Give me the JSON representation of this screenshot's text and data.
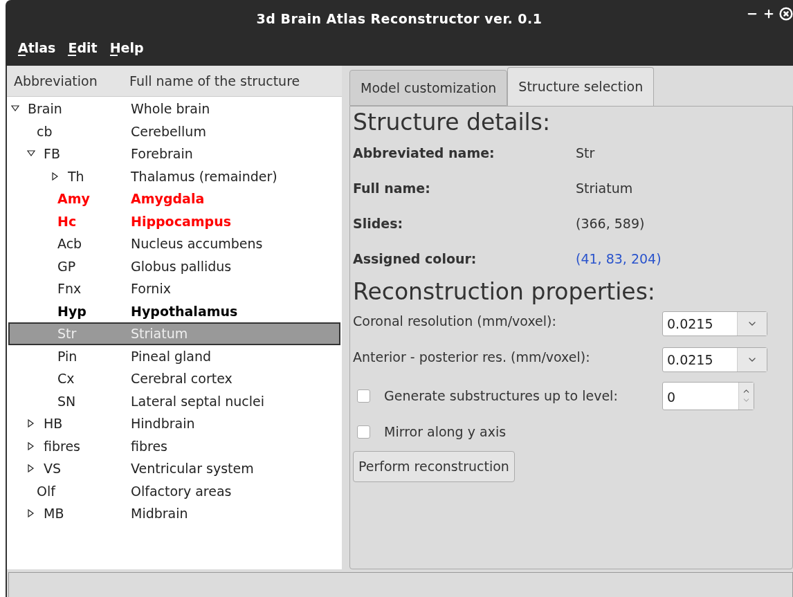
{
  "window": {
    "title": "3d Brain Atlas Reconstructor ver. 0.1"
  },
  "menu": [
    {
      "label": "Atlas"
    },
    {
      "label": "Edit"
    },
    {
      "label": "Help"
    }
  ],
  "tree": {
    "columns": [
      "Abbreviation",
      "Full name of the structure"
    ],
    "items": [
      {
        "abbr": "Brain",
        "name": "Whole brain",
        "kind": "normal",
        "selected": false,
        "expanded": true,
        "children": [
          {
            "abbr": "cb",
            "name": "Cerebellum",
            "kind": "normal",
            "selected": false
          },
          {
            "abbr": "FB",
            "name": "Forebrain",
            "kind": "normal",
            "selected": false,
            "expanded": true,
            "children": [
              {
                "abbr": "Th",
                "name": "Thalamus (remainder)",
                "kind": "normal",
                "selected": false,
                "expanded": false
              },
              {
                "abbr": "Amy",
                "name": "Amygdala",
                "kind": "red",
                "selected": false
              },
              {
                "abbr": "Hc",
                "name": "Hippocampus",
                "kind": "red",
                "selected": false
              },
              {
                "abbr": "Acb",
                "name": "Nucleus accumbens",
                "kind": "normal",
                "selected": false
              },
              {
                "abbr": "GP",
                "name": "Globus pallidus",
                "kind": "normal",
                "selected": false
              },
              {
                "abbr": "Fnx",
                "name": "Fornix",
                "kind": "normal",
                "selected": false
              },
              {
                "abbr": "Hyp",
                "name": "Hypothalamus",
                "kind": "bold",
                "selected": false
              },
              {
                "abbr": "Str",
                "name": "Striatum",
                "kind": "normal",
                "selected": true
              },
              {
                "abbr": "Pin",
                "name": "Pineal gland",
                "kind": "normal",
                "selected": false
              },
              {
                "abbr": "Cx",
                "name": "Cerebral cortex",
                "kind": "normal",
                "selected": false
              },
              {
                "abbr": "SN",
                "name": "Lateral septal nuclei",
                "kind": "normal",
                "selected": false
              }
            ]
          },
          {
            "abbr": "HB",
            "name": "Hindbrain",
            "kind": "normal",
            "selected": false,
            "expanded": false
          },
          {
            "abbr": "fibres",
            "name": "fibres",
            "kind": "normal",
            "selected": false,
            "expanded": false
          },
          {
            "abbr": "VS",
            "name": "Ventricular system",
            "kind": "normal",
            "selected": false,
            "expanded": false
          },
          {
            "abbr": "Olf",
            "name": "Olfactory areas",
            "kind": "normal",
            "selected": false
          },
          {
            "abbr": "MB",
            "name": "Midbrain",
            "kind": "normal",
            "selected": false,
            "expanded": false
          }
        ]
      }
    ]
  },
  "tabs": [
    {
      "label": "Model customization",
      "selected": false
    },
    {
      "label": "Structure selection",
      "selected": true
    }
  ],
  "details": {
    "heading": "Structure details:",
    "rows": [
      {
        "label": "Abbreviated name:",
        "value": "Str"
      },
      {
        "label": "Full name:",
        "value": "Striatum"
      },
      {
        "label": "Slides:",
        "value": "(366, 589)"
      },
      {
        "label": "Assigned colour:",
        "value": "(41, 83, 204)",
        "color": "#2953cc"
      }
    ]
  },
  "reconstruction": {
    "heading": "Reconstruction properties:",
    "fields": [
      {
        "kind": "combo",
        "label": "Coronal resolution (mm/voxel):",
        "value": "0.0215"
      },
      {
        "kind": "combo",
        "label": "Anterior - posterior res. (mm/voxel):",
        "value": "0.0215"
      },
      {
        "kind": "spin",
        "label": "Generate substructures up to level:",
        "value": "0",
        "checked": false
      },
      {
        "kind": "check",
        "label": "Mirror along y axis",
        "checked": false
      }
    ],
    "button": "Perform reconstruction"
  }
}
